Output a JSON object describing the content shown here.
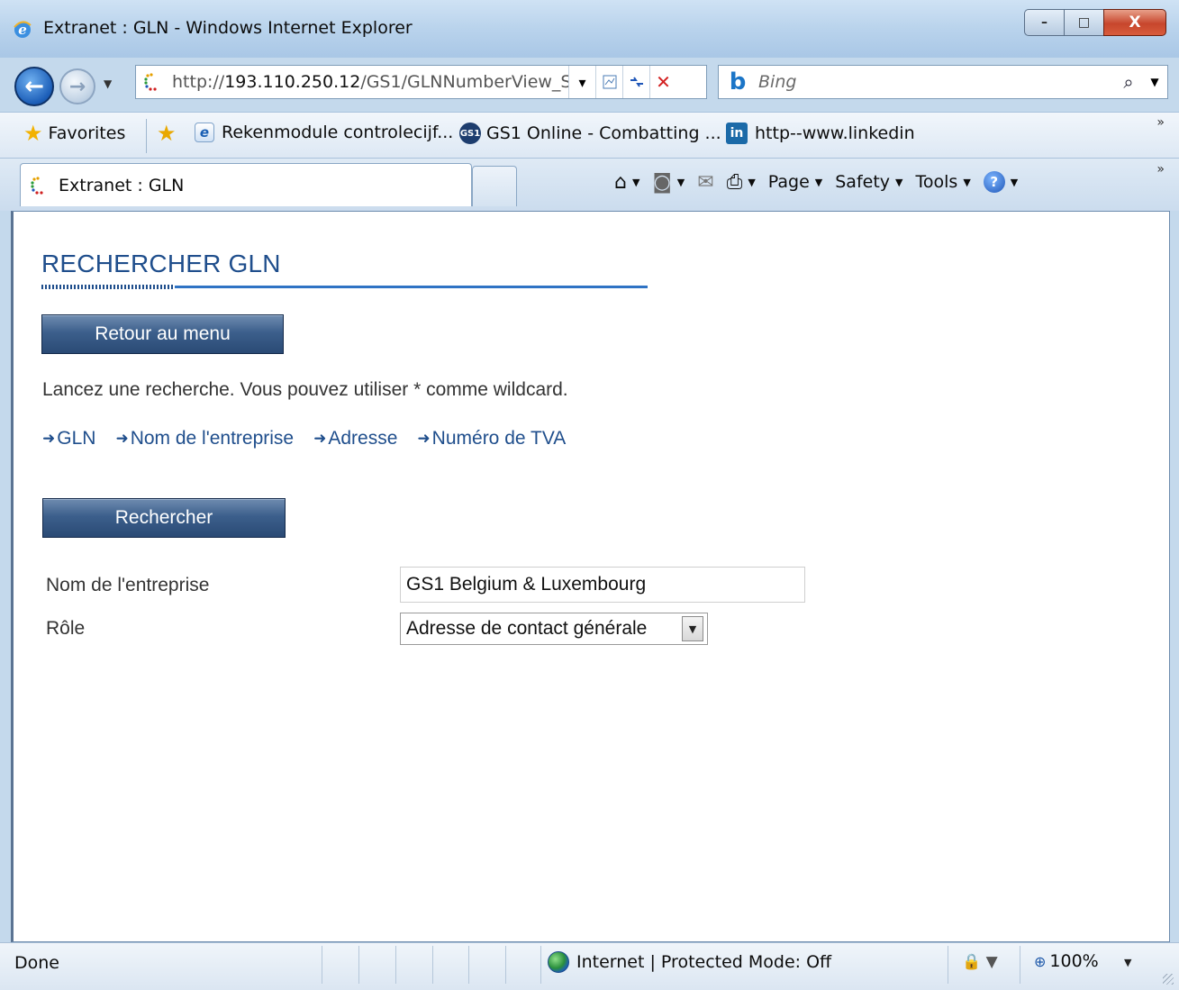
{
  "window": {
    "title": "Extranet : GLN - Windows Internet Explorer",
    "minimize": "–",
    "maximize": "□",
    "close": "X"
  },
  "address_bar": {
    "url_prefix": "http://",
    "url_host": "193.110.250.12",
    "url_path": "/GS1/GLNNumberView_Sear",
    "dropdown": "▾"
  },
  "search_bar": {
    "placeholder": "Bing",
    "logo": "b",
    "go_icon": "⌕"
  },
  "favorites_bar": {
    "favorites_label": "Favorites",
    "items": [
      {
        "label": "Rekenmodule controlecijf...",
        "icon": "ie-page-icon"
      },
      {
        "label": "GS1 Online - Combatting ...",
        "icon": "gs1-icon"
      },
      {
        "label": "http--www.linkedin",
        "icon": "linkedin-icon"
      }
    ],
    "more": "»"
  },
  "tabs": [
    {
      "label": "Extranet : GLN",
      "active": true
    }
  ],
  "command_bar": {
    "page": "Page",
    "safety": "Safety",
    "tools": "Tools",
    "help": "?"
  },
  "page": {
    "title": "RECHERCHER GLN",
    "retour_button": "Retour au menu",
    "intro_text": "Lancez une recherche. Vous pouvez utiliser * comme wildcard.",
    "search_links": [
      {
        "label": "GLN"
      },
      {
        "label": "Nom de l'entreprise"
      },
      {
        "label": "Adresse"
      },
      {
        "label": "Numéro de TVA"
      }
    ],
    "search_button": "Rechercher",
    "form": {
      "company_label": "Nom de l'entreprise",
      "company_value": "GS1 Belgium & Luxembourg",
      "role_label": "Rôle",
      "role_value": "Adresse de contact générale"
    }
  },
  "status_bar": {
    "status": "Done",
    "zone": "Internet | Protected Mode: Off",
    "zoom": "100%"
  },
  "colors": {
    "accent": "#1f4e8c",
    "button_dark": "#2a4a75",
    "rule_blue": "#2f73c4"
  }
}
